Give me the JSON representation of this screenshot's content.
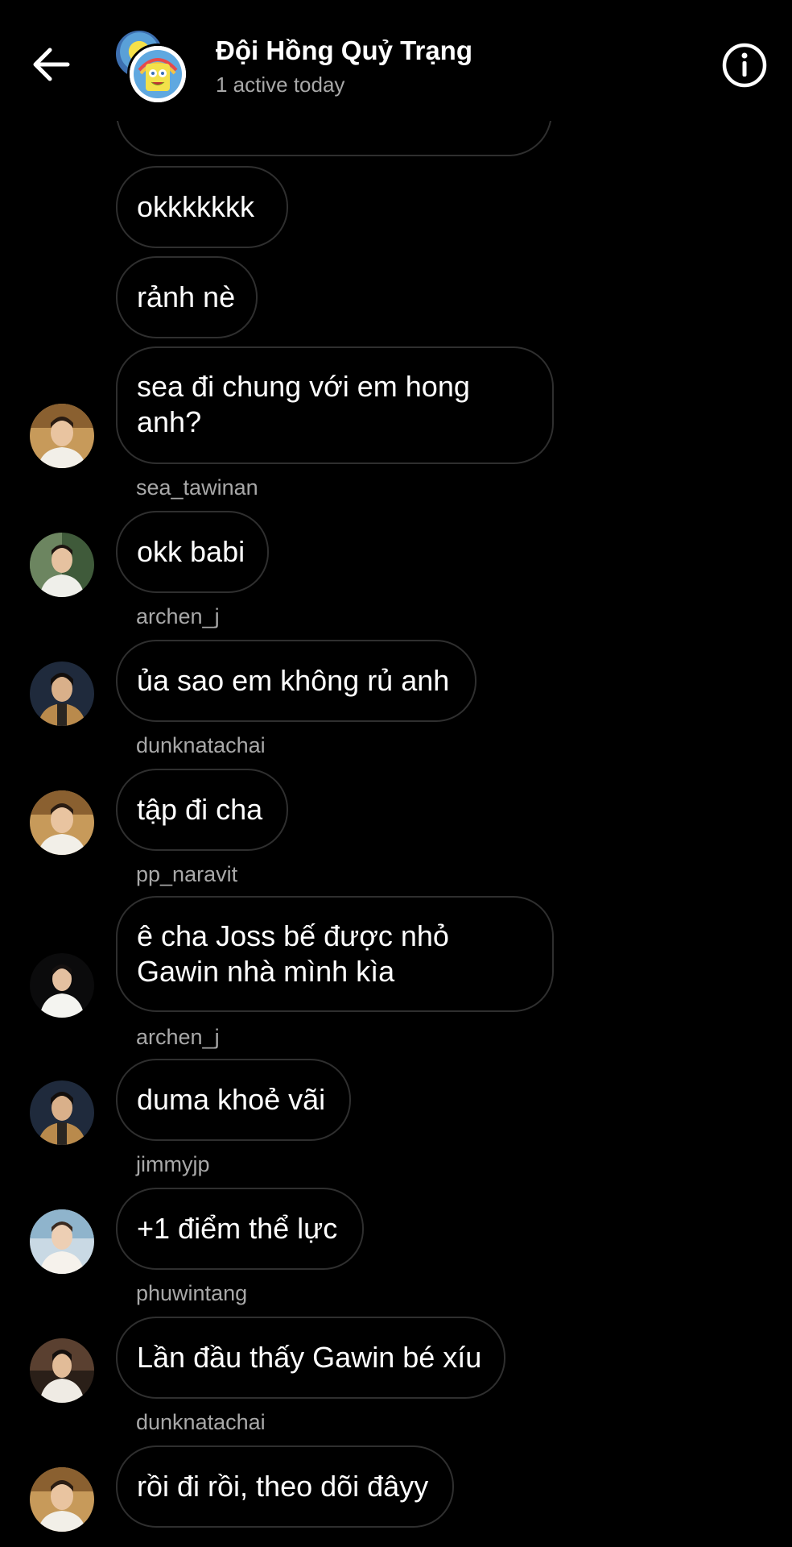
{
  "header": {
    "title": "Đội Hồng Quỷ Trạng",
    "subtitle": "1 active today"
  },
  "messages": [
    {
      "sender": "",
      "text": "okkkkkkk"
    },
    {
      "sender": "",
      "text": "rảnh nè"
    },
    {
      "sender": "",
      "text": "sea đi chung với em hong anh?"
    },
    {
      "sender": "sea_tawinan",
      "text": "okk babi"
    },
    {
      "sender": "archen_j",
      "text": "ủa sao em không rủ anh"
    },
    {
      "sender": "dunknatachai",
      "text": "tập đi cha"
    },
    {
      "sender": "pp_naravit",
      "text": "ê cha Joss bế được nhỏ Gawin nhà mình kìa"
    },
    {
      "sender": "archen_j",
      "text": "duma khoẻ vãi"
    },
    {
      "sender": "jimmyjp",
      "text": "+1 điểm thể lực"
    },
    {
      "sender": "phuwintang",
      "text": "Lần đầu thấy Gawin bé xíu"
    },
    {
      "sender": "dunknatachai",
      "text": "rồi đi rồi, theo dõi đâyy"
    }
  ],
  "icons": {
    "back": "arrow-left-icon",
    "info": "info-circle-icon"
  },
  "colors": {
    "background": "#000000",
    "bubble_border": "#2f2f2f",
    "secondary_text": "#a8a8a8"
  }
}
